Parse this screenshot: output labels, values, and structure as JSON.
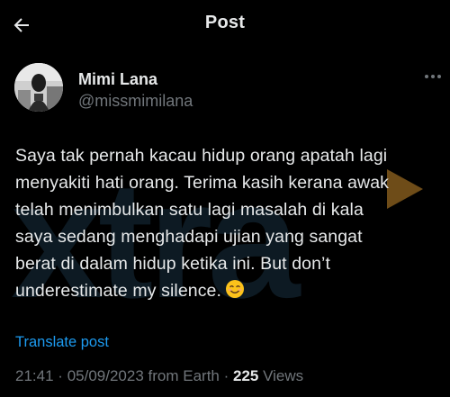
{
  "header": {
    "title": "Post"
  },
  "author": {
    "display_name": "Mimi Lana",
    "handle": "@missmimilana"
  },
  "tweet": {
    "lines": [
      "Saya tak pernah kacau hidup orang apatah lagi",
      "menyakiti hati orang. Terima kasih kerana awak",
      "telah menimbulkan satu lagi masalah di kala",
      "saya sedang menghadapi ujian yang sangat",
      "berat di dalam hidup ketika ini. But don’t",
      "underestimate my silence."
    ],
    "emoji": "smiling-face-with-smiling-eyes"
  },
  "translate_label": "Translate post",
  "meta": {
    "time": "21:41",
    "separator": "·",
    "date": "05/09/2023",
    "source": "from Earth",
    "views_count": "225",
    "views_label": "Views"
  },
  "watermark": {
    "text": "xtra"
  },
  "colors": {
    "background": "#000000",
    "text": "#e7e9ea",
    "secondary": "#71767b",
    "link": "#1d9bf0"
  }
}
